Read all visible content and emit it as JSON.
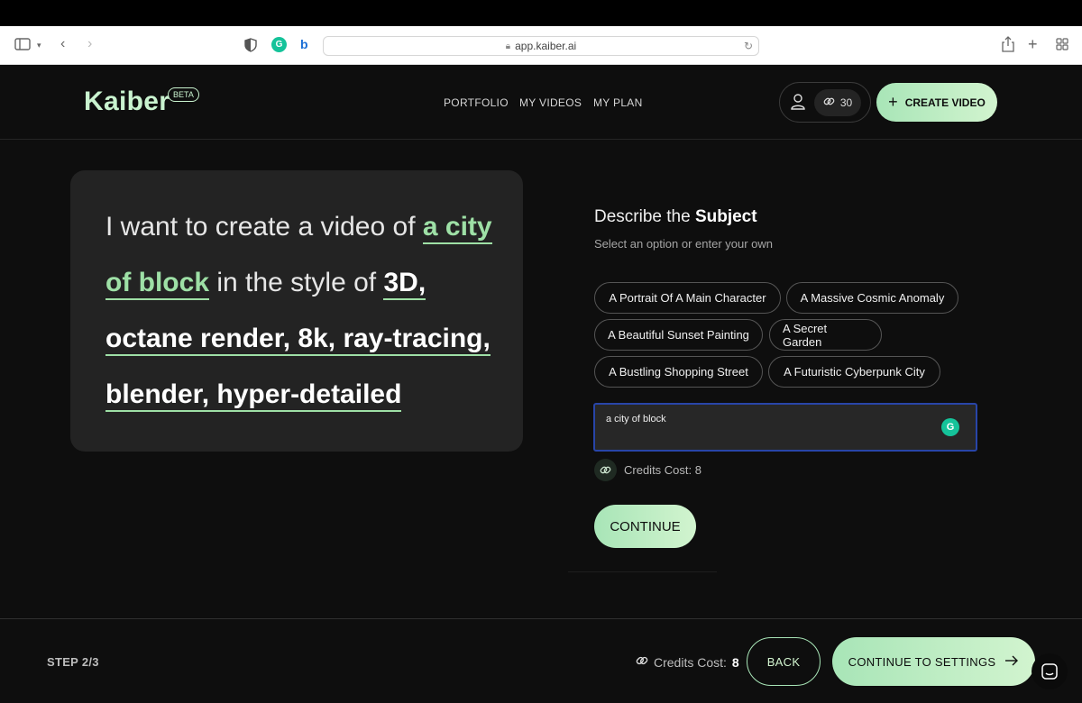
{
  "browser": {
    "url": "app.kaiber.ai"
  },
  "header": {
    "logo": "Kaiber",
    "badge": "BETA",
    "nav": [
      "PORTFOLIO",
      "MY VIDEOS",
      "MY PLAN"
    ],
    "credits": "30",
    "create_label": "CREATE VIDEO"
  },
  "prompt": {
    "prefix": "I want to create a video of",
    "subject": "a city of block",
    "middle": "in the style of",
    "style": "3D, octane render, 8k, ray-tracing, blender, hyper-detailed"
  },
  "subject_panel": {
    "title_prefix": "Describe the",
    "title_bold": "Subject",
    "subtitle": "Select an option or enter your own",
    "options": [
      "A Portrait Of A Main Character",
      "A Massive Cosmic Anomaly",
      "A Beautiful Sunset Painting",
      "A Secret Garden",
      "A Bustling Shopping Street",
      "A Futuristic Cyberpunk City"
    ],
    "input_value": "a city of block",
    "credits_cost": "Credits Cost: 8",
    "continue_label": "CONTINUE"
  },
  "footer": {
    "step": "STEP 2/3",
    "credits_label": "Credits Cost:",
    "credits_value": "8",
    "back_label": "BACK",
    "continue_label": "CONTINUE TO SETTINGS"
  },
  "colors": {
    "accent": "#a8e5b7",
    "highlight": "#9ee0a6",
    "background": "#0e0e0e",
    "card": "#232323"
  }
}
